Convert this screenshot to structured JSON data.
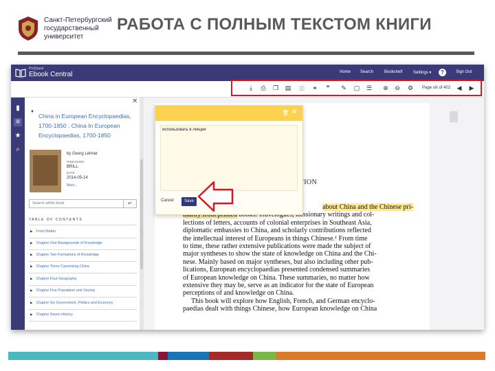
{
  "header": {
    "university_lines": [
      "Санкт-Петербургский",
      "государственный",
      "университет"
    ],
    "title": "РАБОТА С ПОЛНЫМ ТЕКСТОМ КНИГИ"
  },
  "app": {
    "brand_small": "ProQuest",
    "brand_main": "Ebook Central",
    "nav": [
      "Home",
      "Search",
      "Bookshelf",
      "Settings ▾",
      "Sign Out"
    ],
    "page_indicator": "Page xiii of 402",
    "toolbar_icons": [
      "download-icon",
      "print-icon",
      "copy-icon",
      "print-preview-icon",
      "highlight-off-icon",
      "link-icon",
      "cite-icon",
      "highlighter-icon",
      "note-icon",
      "note-list-icon",
      "bookmark-icon",
      "zoom-in-icon",
      "zoom-out-icon",
      "fit-width-icon",
      "previous-page-icon",
      "next-page-icon"
    ]
  },
  "sidebar": {
    "book_title": "China in European Encyclopaedias, 1700-1850 : China In European Encyclopaedias, 1700-1850",
    "author": "by Georg Lehner",
    "publisher_label": "PUBLISHER",
    "publisher": "BRILL",
    "date_label": "DATE",
    "date": "2014-05-14",
    "more": "More...",
    "search_placeholder": "Search within book",
    "toc_heading": "TABLE OF CONTENTS",
    "toc": [
      "Front Matter",
      "Chapter One Backgrounds of Knowledge",
      "Chapter Two Formations of Knowledge",
      "Chapter Three Canonizing China",
      "Chapter Four Geography",
      "Chapter Five Population and Society",
      "Chapter Six Government, Politics and Economy",
      "Chapter Seven History"
    ]
  },
  "note": {
    "text": "использовать в лекции",
    "cancel": "Cancel",
    "save": "Save"
  },
  "page": {
    "heading_fragment": "UCTION",
    "highlighted": "about China and the Chinese primarily from printed",
    "lines": [
      "about China and the Chinese pri-",
      "marily from printed books. Travelogues, missionary writings and col-",
      "lections of letters, accounts of colonial enterprises in Southeast Asia,",
      "diplomatic embassies to China, and scholarly contributions reflected",
      "the intellectual interest of Europeans in things Chinese.¹ From time",
      "to time, these rather extensive publications were made the subject of",
      "major syntheses to show the state of knowledge on China and the Chi-",
      "nese. Mainly based on major syntheses, but also including other pub-",
      "lications, European encyclopaedias presented condensed summaries",
      "of European knowledge on China. These summaries, no matter how",
      "extensive they may be, serve as an indicator for the state of European",
      "perceptions of and knowledge on China.",
      "This book will explore how English, French, and German encyclo-",
      "paedias dealt with things Chinese, how European knowledge on China"
    ]
  },
  "colors": {
    "nav_bg": "#3b3a78",
    "highlight_frame": "#e1121b",
    "note_header": "#fcd14f",
    "bar": [
      "#4db8bf",
      "#8a1538",
      "#1a75b8",
      "#a52a2a",
      "#7ab648",
      "#d97b2b"
    ]
  }
}
